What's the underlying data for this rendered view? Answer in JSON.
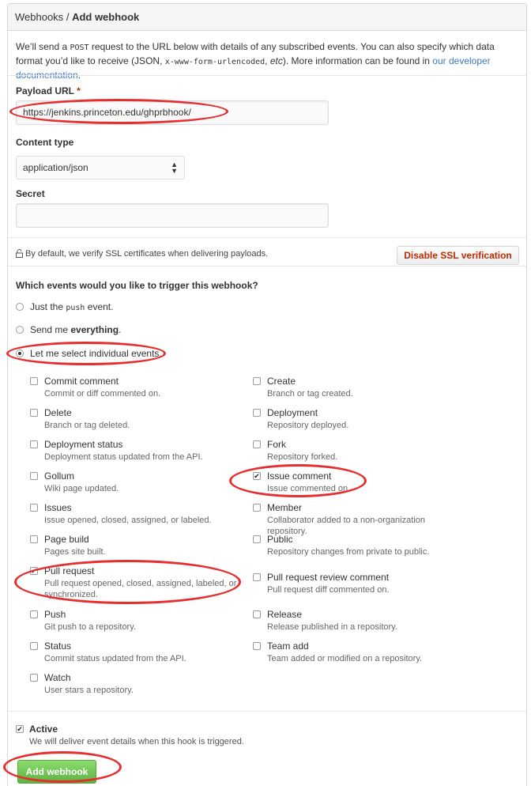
{
  "header": {
    "breadcrumb_parent": "Webhooks",
    "separator": "/",
    "title": "Add webhook"
  },
  "intro": {
    "text_1": "We’ll send a ",
    "code_post": "POST",
    "text_2": " request to the URL below with details of any subscribed events. You can also specify which data format you’d like to receive (JSON, ",
    "code_form": "x-www-form-urlencoded",
    "text_3": ", ",
    "etc": "etc",
    "text_4": "). More information can be found in ",
    "link": "our developer documentation",
    "text_5": "."
  },
  "payload": {
    "label": "Payload URL",
    "required_mark": "*",
    "value": "https://jenkins.princeton.edu/ghprbhook/"
  },
  "content_type": {
    "label": "Content type",
    "value": "application/json"
  },
  "secret": {
    "label": "Secret",
    "value": ""
  },
  "ssl": {
    "text": "By default, we verify SSL certificates when delivering payloads.",
    "button": "Disable SSL verification"
  },
  "events": {
    "question": "Which events would you like to trigger this webhook?",
    "opt_push_a": "Just the ",
    "opt_push_code": "push",
    "opt_push_b": " event.",
    "opt_all_a": "Send me ",
    "opt_all_b": "everything",
    "opt_all_c": ".",
    "opt_select": "Let me select individual events.",
    "selected_option": "select",
    "items": [
      {
        "name": "Commit comment",
        "desc": "Commit or diff commented on.",
        "checked": false
      },
      {
        "name": "Create",
        "desc": "Branch or tag created.",
        "checked": false
      },
      {
        "name": "Delete",
        "desc": "Branch or tag deleted.",
        "checked": false
      },
      {
        "name": "Deployment",
        "desc": "Repository deployed.",
        "checked": false
      },
      {
        "name": "Deployment status",
        "desc": "Deployment status updated from the API.",
        "checked": false
      },
      {
        "name": "Fork",
        "desc": "Repository forked.",
        "checked": false
      },
      {
        "name": "Gollum",
        "desc": "Wiki page updated.",
        "checked": false
      },
      {
        "name": "Issue comment",
        "desc": "Issue commented on.",
        "checked": true
      },
      {
        "name": "Issues",
        "desc": "Issue opened, closed, assigned, or labeled.",
        "checked": false
      },
      {
        "name": "Member",
        "desc": "Collaborator added to a non-organization repository.",
        "checked": false
      },
      {
        "name": "Page build",
        "desc": "Pages site built.",
        "checked": false
      },
      {
        "name": "Public",
        "desc": "Repository changes from private to public.",
        "checked": false
      },
      {
        "name": "Pull request",
        "desc": "Pull request opened, closed, assigned, labeled, or synchronized.",
        "checked": true
      },
      {
        "name": "Pull request review comment",
        "desc": "Pull request diff commented on.",
        "checked": false
      },
      {
        "name": "Push",
        "desc": "Git push to a repository.",
        "checked": false
      },
      {
        "name": "Release",
        "desc": "Release published in a repository.",
        "checked": false
      },
      {
        "name": "Status",
        "desc": "Commit status updated from the API.",
        "checked": false
      },
      {
        "name": "Team add",
        "desc": "Team added or modified on a repository.",
        "checked": false
      },
      {
        "name": "Watch",
        "desc": "User stars a repository.",
        "checked": false
      }
    ]
  },
  "active": {
    "label": "Active",
    "desc": "We will deliver event details when this hook is triggered.",
    "checked": true
  },
  "submit": {
    "label": "Add webhook"
  },
  "colors": {
    "annotation": "#e62e2e",
    "primary_button": "#60b044",
    "danger_text": "#bd2c00",
    "link": "#4078c0"
  }
}
